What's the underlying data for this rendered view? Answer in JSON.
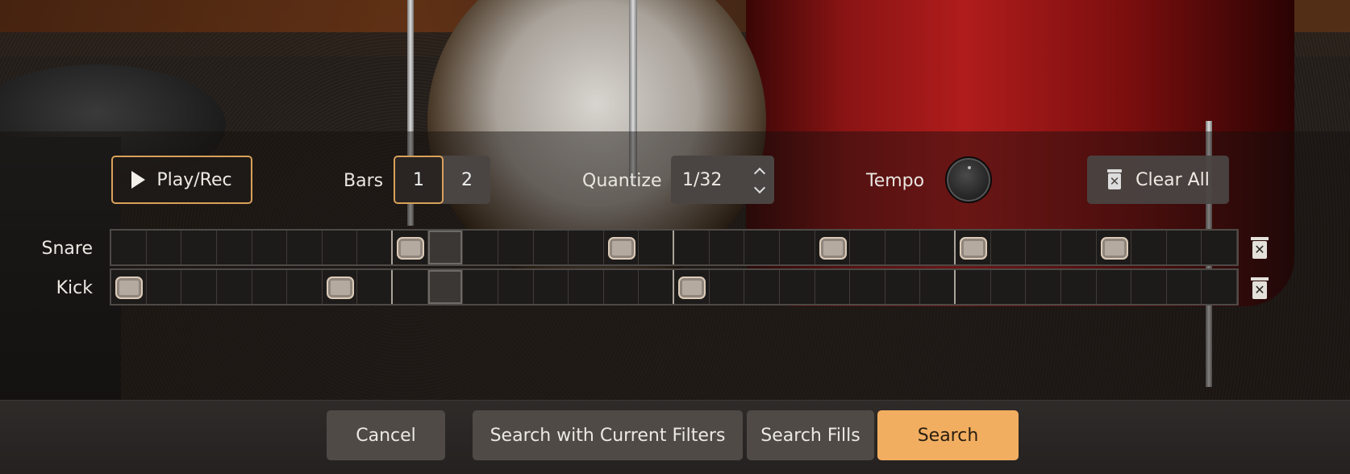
{
  "toolbar": {
    "play_label": "Play/Rec",
    "bars_label": "Bars",
    "bars_options": [
      "1",
      "2"
    ],
    "bars_selected": "1",
    "quantize_label": "Quantize",
    "quantize_value": "1/32",
    "tempo_label": "Tempo",
    "clear_all_label": "Clear All"
  },
  "grid": {
    "steps": 32,
    "current_step": 10,
    "beat_marks": [
      8,
      16,
      24
    ],
    "rows": [
      {
        "label": "Snare",
        "notes": [
          9,
          15,
          21,
          25,
          29
        ]
      },
      {
        "label": "Kick",
        "notes": [
          1,
          7,
          17
        ]
      }
    ]
  },
  "footer": {
    "cancel_label": "Cancel",
    "search_filters_label": "Search with Current Filters",
    "search_fills_label": "Search Fills",
    "search_label": "Search"
  },
  "colors": {
    "accent": "#f2ae60",
    "outline_accent": "#d9a15a",
    "button_bg": "#4f4a46"
  },
  "icons": [
    "play-icon",
    "trash-icon",
    "chevron-up-icon",
    "chevron-down-icon",
    "tempo-knob"
  ]
}
